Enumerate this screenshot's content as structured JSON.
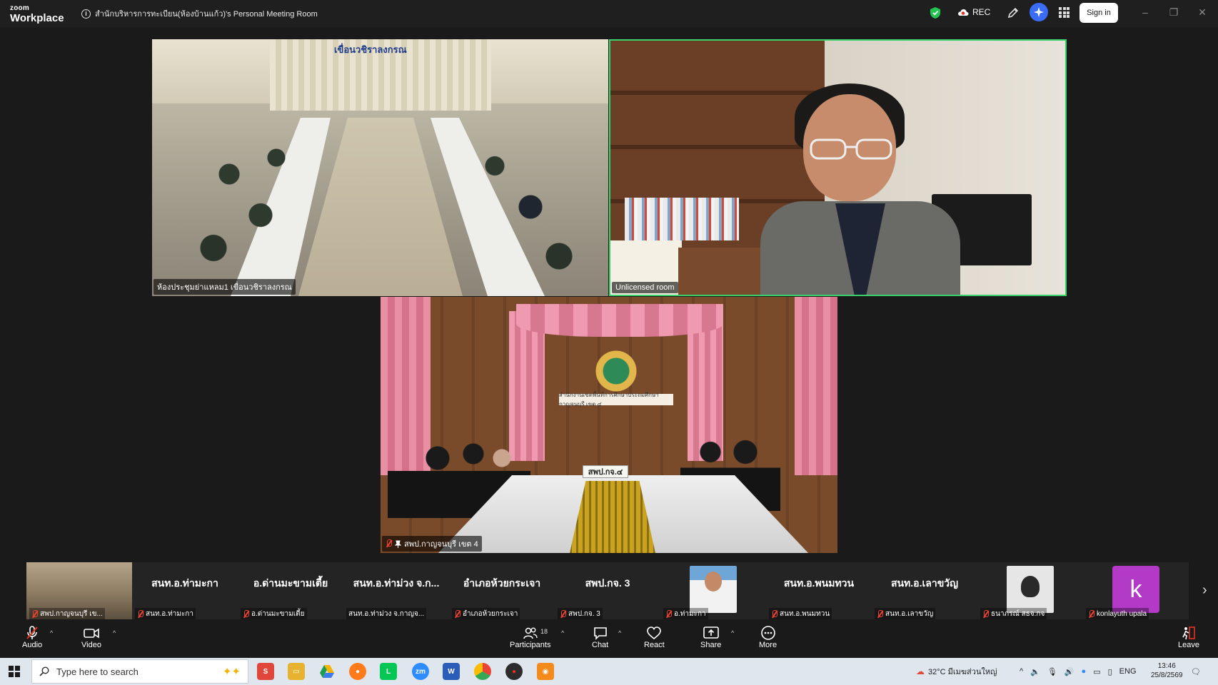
{
  "app": {
    "logo_top": "zoom",
    "logo_bottom": "Workplace",
    "meeting_title": "สำนักบริหารการทะเบียน(ห้องบ้านแก้ว)'s Personal Meeting Room",
    "rec_label": "REC",
    "sign_in_label": "Sign in"
  },
  "videos": [
    {
      "name": "ห้องประชุมย่าแหลม1 เขื่อนวชิราลงกรณ",
      "banner": "เขื่อนวชิราลงกรณ",
      "muted": false
    },
    {
      "name": "Unlicensed room",
      "muted": false,
      "active_speaker": true
    },
    {
      "name": "สพป.กาญจนบุรี เขต 4",
      "sign": "สำนักงานเขตพื้นที่การศึกษาประถมศึกษากาญจนบุรี เขต ๔",
      "nameplate": "สพป.กจ.๔",
      "muted": true,
      "pinned": true
    }
  ],
  "participants": [
    {
      "display": "",
      "label": "สพป.กาญจนบุรี เข...",
      "type": "video",
      "muted": true
    },
    {
      "display": "สนท.อ.ท่ามะกา",
      "label": "สนท.อ.ท่ามะกา",
      "type": "name",
      "muted": true
    },
    {
      "display": "อ.ด่านมะขามเตี้ย",
      "label": "อ.ด่านมะขามเตี้ย",
      "type": "name",
      "muted": true
    },
    {
      "display": "สนท.อ.ท่าม่วง จ.ก...",
      "label": "สนท.อ.ท่าม่วง จ.กาญจ...",
      "type": "name",
      "muted": false
    },
    {
      "display": "อำเภอห้วยกระเจา",
      "label": "อำเภอห้วยกระเจา",
      "type": "name",
      "muted": true
    },
    {
      "display": "สพป.กจ. 3",
      "label": "สพป.กจ. 3",
      "type": "name",
      "muted": true
    },
    {
      "display": "",
      "label": "อ.ท่ามะกา",
      "type": "photo",
      "muted": true
    },
    {
      "display": "สนท.อ.พนมทวน",
      "label": "สนท.อ.พนมทวน",
      "type": "name",
      "muted": true
    },
    {
      "display": "สนท.อ.เลาขวัญ",
      "label": "สนท.อ.เลาขวัญ",
      "type": "name",
      "muted": true
    },
    {
      "display": "",
      "label": "ธนาภรณ์ สธจ.กจ",
      "type": "photo2",
      "muted": true
    },
    {
      "display": "k",
      "label": "konlayuth upala",
      "type": "letter",
      "muted": true
    }
  ],
  "toolbar": {
    "audio": "Audio",
    "video": "Video",
    "participants": "Participants",
    "participants_count": "18",
    "chat": "Chat",
    "react": "React",
    "share": "Share",
    "more": "More",
    "leave": "Leave"
  },
  "taskbar": {
    "search_placeholder": "Type here to search",
    "weather": "32°C  มีเมฆส่วนใหญ่",
    "lang": "ENG",
    "time": "13:46",
    "date": "25/8/2569"
  },
  "colors": {
    "active_speaker_border": "#3ad16c",
    "muted_red": "#e43322",
    "ai_blue": "#3b6cf5",
    "avatar_purple": "#b23ac7"
  }
}
